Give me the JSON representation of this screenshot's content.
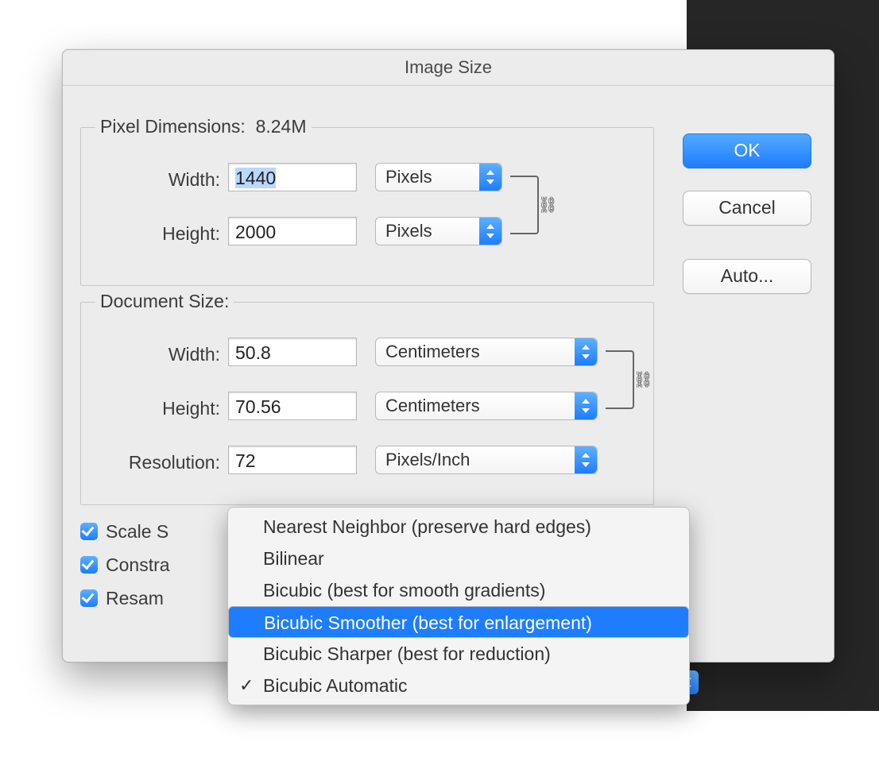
{
  "title": "Image Size",
  "buttons": {
    "ok": "OK",
    "cancel": "Cancel",
    "auto": "Auto..."
  },
  "pixel": {
    "legend_prefix": "Pixel Dimensions:",
    "legend_size": "8.24M",
    "width_label": "Width:",
    "width_value": "1440",
    "width_unit": "Pixels",
    "height_label": "Height:",
    "height_value": "2000",
    "height_unit": "Pixels"
  },
  "doc": {
    "legend": "Document Size:",
    "width_label": "Width:",
    "width_value": "50.8",
    "width_unit": "Centimeters",
    "height_label": "Height:",
    "height_value": "70.56",
    "height_unit": "Centimeters",
    "res_label": "Resolution:",
    "res_value": "72",
    "res_unit": "Pixels/Inch"
  },
  "checks": {
    "scale": "Scale S",
    "constrain": "Constra",
    "resample": "Resam"
  },
  "resample_menu": {
    "items": [
      "Nearest Neighbor (preserve hard edges)",
      "Bilinear",
      "Bicubic (best for smooth gradients)",
      "Bicubic Smoother (best for enlargement)",
      "Bicubic Sharper (best for reduction)",
      "Bicubic Automatic"
    ],
    "highlighted_index": 3,
    "checked_index": 5
  },
  "link_icon": "⛓"
}
